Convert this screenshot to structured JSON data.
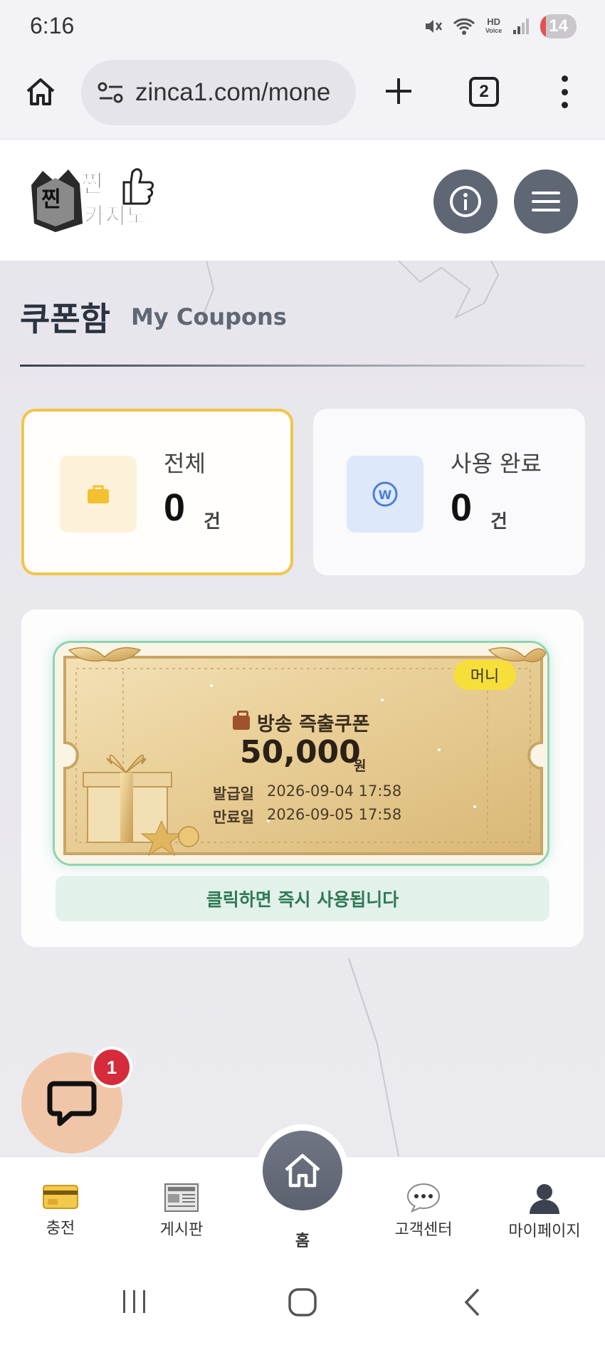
{
  "status_bar": {
    "time": "6:16",
    "hd_label_top": "HD",
    "hd_label_bottom": "Voice",
    "battery": "14"
  },
  "browser": {
    "url": "zinca1.com/mone",
    "tab_count": "2"
  },
  "header": {
    "logo_alt": "찐카지노"
  },
  "page": {
    "title": "쿠폰함",
    "subtitle": "My Coupons"
  },
  "stats": [
    {
      "label": "전체",
      "count": "0",
      "unit": "건",
      "icon": "briefcase-icon",
      "accent": "#f0c64a"
    },
    {
      "label": "사용 완료",
      "count": "0",
      "unit": "건",
      "icon": "won-coin-icon",
      "accent": "#4a7fd8"
    }
  ],
  "coupon": {
    "badge": "머니",
    "title": "방송 즉출쿠폰",
    "amount": "50,000",
    "amount_unit": "원",
    "issue_label": "발급일",
    "issue_date": "2026-09-04 17:58",
    "expire_label": "만료일",
    "expire_date": "2026-09-05 17:58",
    "hint": "클릭하면 즉시 사용됩니다"
  },
  "chat": {
    "badge_count": "1"
  },
  "bottom_nav": {
    "charge": "충전",
    "board": "게시판",
    "home": "홈",
    "support": "고객센터",
    "mypage": "마이페이지"
  }
}
